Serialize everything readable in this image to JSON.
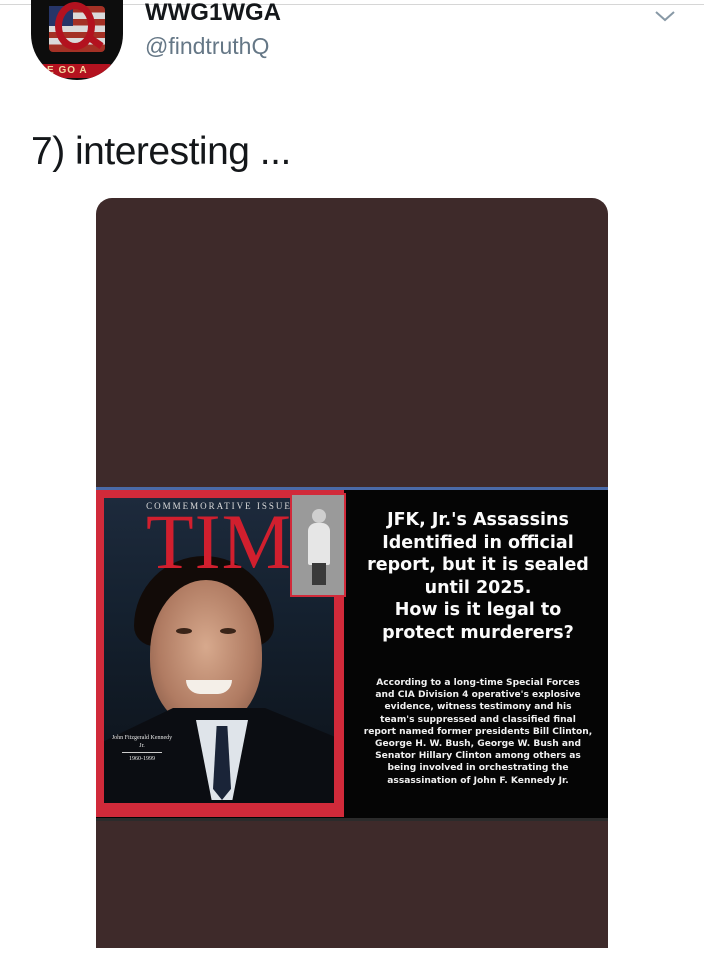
{
  "header": {
    "display_name": "WWG1WGA",
    "handle": "@findtruthQ",
    "avatar_badge": "E GO A"
  },
  "tweet": {
    "text": "7) interesting ..."
  },
  "media": {
    "cover": {
      "issue_label": "COMMEMORATIVE ISSUE",
      "logo": "TIM",
      "caption_name": "John Fitzgerald Kennedy Jr.",
      "caption_years": "1960-1999"
    },
    "headline": "JFK, Jr.'s Assassins\nIdentified in official\nreport, but it is sealed\nuntil 2025.\nHow is it legal to\nprotect murderers?",
    "body": "According to a long-time Special Forces\nand CIA Division 4 operative's explosive\nevidence, witness testimony and his\nteam's suppressed and classified final\nreport named former presidents Bill Clinton,\nGeorge H. W. Bush, George W. Bush and\nSenator Hillary Clinton among others as\nbeing involved in orchestrating the\nassassination of John F. Kennedy Jr."
  },
  "icons": {
    "more_menu": "chevron-down-icon",
    "avatar": "q-flag-avatar"
  },
  "colors": {
    "media_background": "#3e2a2a",
    "cover_red": "#d12a3a",
    "handle_gray": "#657786"
  }
}
